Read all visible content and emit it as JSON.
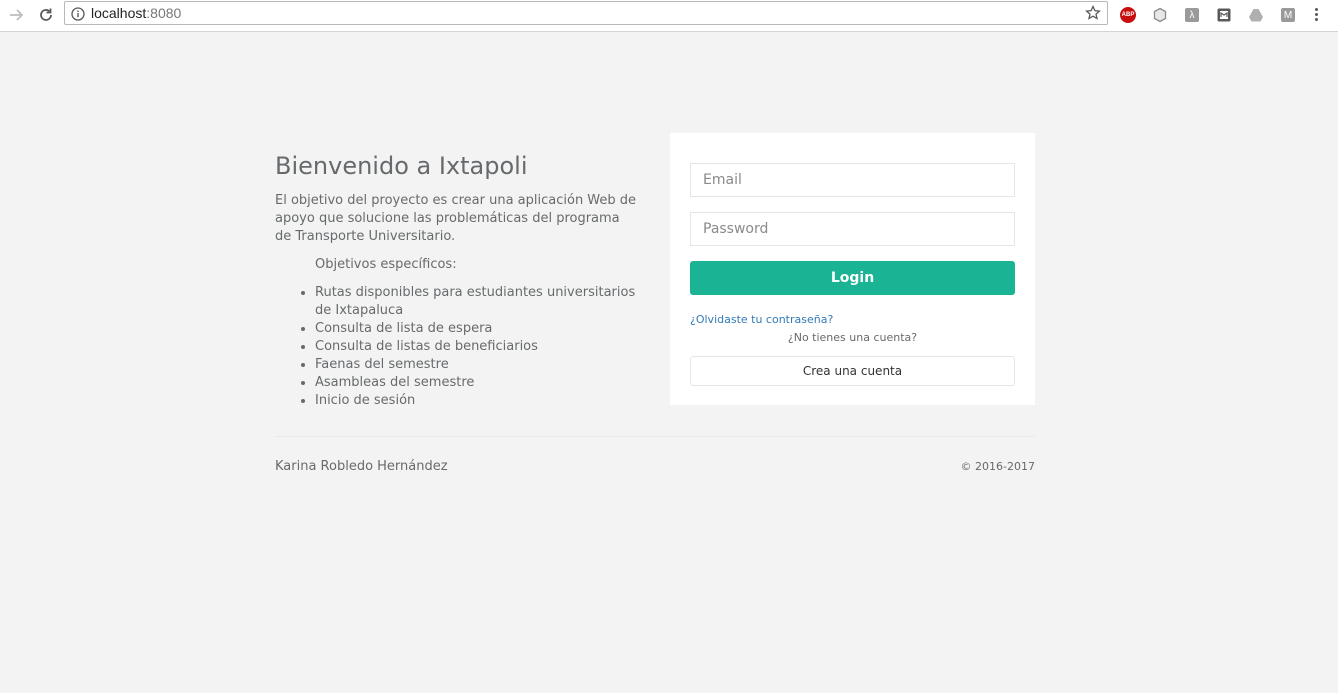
{
  "browser": {
    "url_host": "localhost",
    "url_port": ":8080",
    "extensions": [
      {
        "name": "adblock-plus-icon",
        "label": "ABP"
      },
      {
        "name": "cube-extension-icon",
        "label": ""
      },
      {
        "name": "lambda-extension-icon",
        "label": "λ"
      },
      {
        "name": "screen-extension-icon",
        "label": ""
      },
      {
        "name": "drive-extension-icon",
        "label": ""
      },
      {
        "name": "m-extension-icon",
        "label": "M"
      }
    ]
  },
  "intro": {
    "title": "Bienvenido a Ixtapoli",
    "description": "El objetivo del proyecto es crear una aplicación Web de apoyo que solucione las problemáticas del programa de Transporte Universitario.",
    "objectives_title": "Objetivos específicos:",
    "objectives": [
      "Rutas disponibles para estudiantes universitarios de Ixtapaluca",
      "Consulta de lista de espera",
      "Consulta de listas de beneficiarios",
      "Faenas del semestre",
      "Asambleas del semestre",
      "Inicio de sesión"
    ]
  },
  "login": {
    "email_placeholder": "Email",
    "password_placeholder": "Password",
    "login_label": "Login",
    "forgot_label": "¿Olvidaste tu contraseña?",
    "no_account_label": "¿No tienes una cuenta?",
    "create_label": "Crea una cuenta"
  },
  "footer": {
    "author": "Karina Robledo Hernández",
    "copyright": "© 2016-2017"
  },
  "colors": {
    "background": "#f3f3f3",
    "primary": "#1ab394",
    "link": "#337ab7",
    "text": "#676a6c"
  }
}
